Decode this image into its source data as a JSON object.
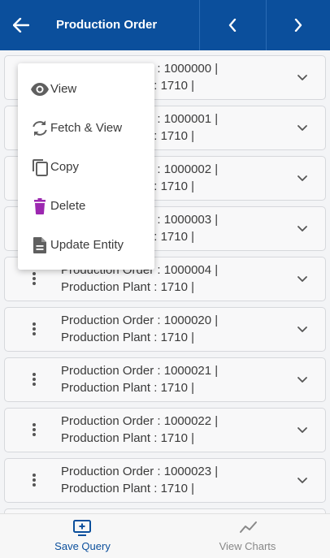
{
  "header": {
    "title": "Production Order"
  },
  "orders": [
    {
      "order_line": "Production Order : 1000000 |",
      "plant_line": "Production Plant : 1710 |"
    },
    {
      "order_line": "Production Order : 1000001 |",
      "plant_line": "Production Plant : 1710 |"
    },
    {
      "order_line": "Production Order : 1000002 |",
      "plant_line": "Production Plant : 1710 |"
    },
    {
      "order_line": "Production Order : 1000003 |",
      "plant_line": "Production Plant : 1710 |"
    },
    {
      "order_line": "Production Order : 1000004 |",
      "plant_line": "Production Plant : 1710 |"
    },
    {
      "order_line": "Production Order : 1000020 |",
      "plant_line": "Production Plant : 1710 |"
    },
    {
      "order_line": "Production Order : 1000021 |",
      "plant_line": "Production Plant : 1710 |"
    },
    {
      "order_line": "Production Order : 1000022 |",
      "plant_line": "Production Plant : 1710 |"
    },
    {
      "order_line": "Production Order : 1000023 |",
      "plant_line": "Production Plant : 1710 |"
    }
  ],
  "context_menu": {
    "items": [
      {
        "label": "View",
        "icon": "eye-icon"
      },
      {
        "label": "Fetch & View",
        "icon": "refresh-icon"
      },
      {
        "label": "Copy",
        "icon": "copy-icon"
      },
      {
        "label": "Delete",
        "icon": "trash-icon"
      },
      {
        "label": "Update Entity",
        "icon": "document-icon"
      }
    ]
  },
  "bottom_nav": {
    "save_query": "Save Query",
    "view_charts": "View Charts"
  },
  "colors": {
    "header_bg": "#0b4f9c",
    "delete_icon": "#9c27b0",
    "active_tab": "#0b4f9c",
    "inactive_tab": "#888888"
  }
}
